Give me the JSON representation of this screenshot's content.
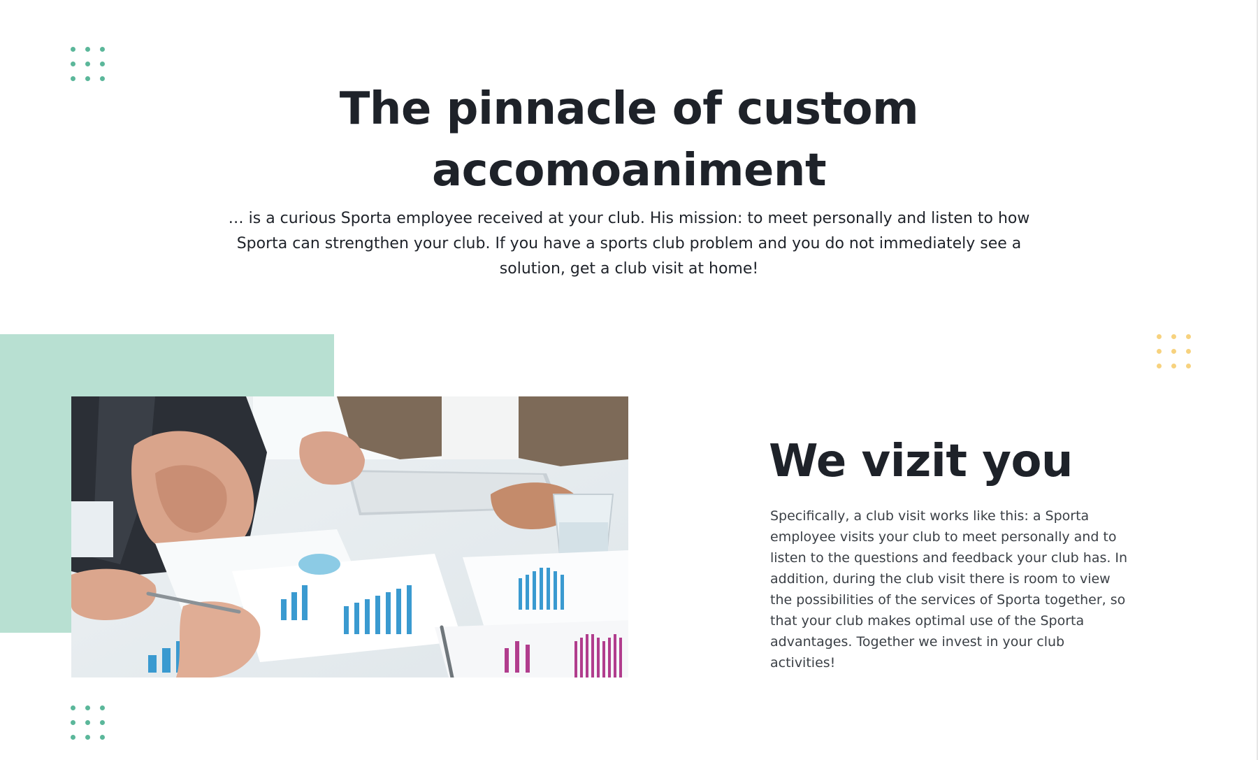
{
  "hero": {
    "title": "The pinnacle of custom accomoaniment",
    "text": "… is a curious Sporta employee received at your club. His mission: to meet personally and listen to how Sporta can strengthen your club. If you have a sports club problem and you do not immediately see a solution, get a club visit at home!"
  },
  "feature": {
    "title": "We vizit you",
    "text": "Specifically, a club visit works like this: a Sporta employee visits your club to meet personally and to listen to the questions and feedback your club has. In addition, during the club visit there is room to view the possibilities of the services of Sporta together, so that your club makes optimal use of the Sporta advantages. Together we invest in your club activities!",
    "image_icon": "business-meeting-photo"
  },
  "colors": {
    "accent_green": "#5bb79a",
    "mint": "#b8e0d2",
    "accent_yellow": "#f7d27e",
    "heading": "#1e2229"
  },
  "decorations": {
    "top_left_dots": "dot-grid-icon",
    "right_dots": "dot-grid-icon",
    "bottom_left_dots": "dot-grid-icon"
  }
}
